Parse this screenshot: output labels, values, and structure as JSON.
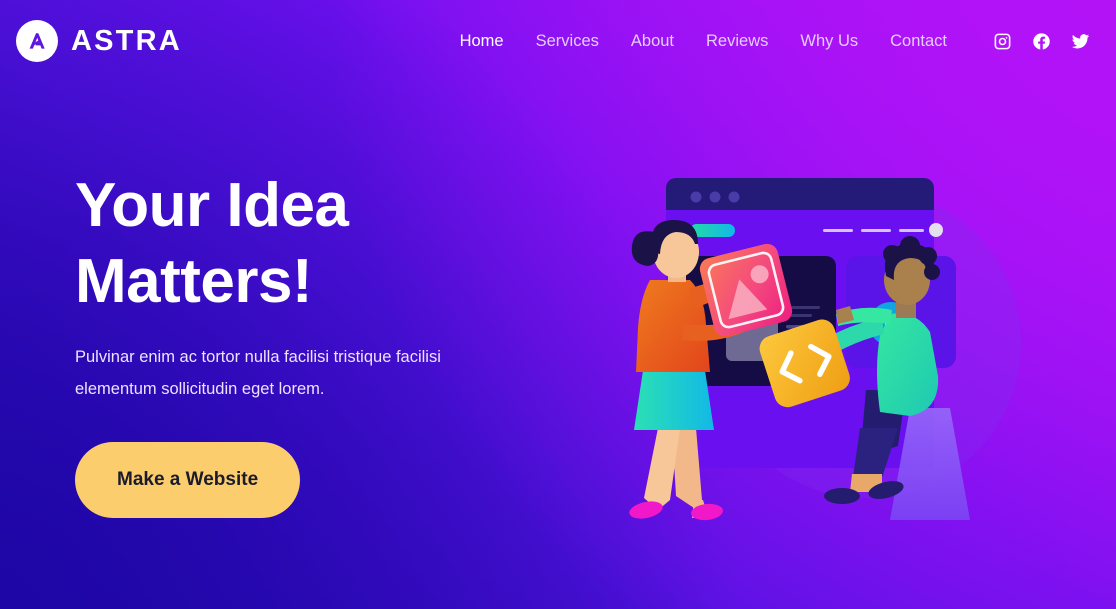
{
  "brand": {
    "name": "ASTRA",
    "logo_icon": "astra-a-logo",
    "logo_bg": "#FFFFFF",
    "logo_glyph_color": "#5C16E0"
  },
  "nav": {
    "items": [
      {
        "label": "Home",
        "active": true
      },
      {
        "label": "Services",
        "active": false
      },
      {
        "label": "About",
        "active": false
      },
      {
        "label": "Reviews",
        "active": false
      },
      {
        "label": "Why Us",
        "active": false
      },
      {
        "label": "Contact",
        "active": false
      }
    ]
  },
  "socials": [
    {
      "name": "instagram-icon",
      "label": "Instagram"
    },
    {
      "name": "facebook-icon",
      "label": "Facebook"
    },
    {
      "name": "twitter-icon",
      "label": "Twitter"
    }
  ],
  "hero": {
    "headline": "Your Idea\nMatters!",
    "subhead": "Pulvinar enim ac tortor nulla facilisi tristique facilisi elementum sollicitudin eget lorem.",
    "cta_label": "Make a Website"
  },
  "illustration": {
    "name": "team-building-website-illustration",
    "browser_mockup": {
      "titlebar_dots": 3,
      "nav_pill_colors": [
        "#22D9A8",
        "#13B9E8"
      ],
      "nav_lines": 3,
      "avatar_dot": "#E2E0EC",
      "video_play_button_color": "#0FA5E0"
    },
    "image_card": {
      "name": "image-placeholder-card",
      "colors": [
        "#F9674F",
        "#EE2B7A"
      ]
    },
    "code_card": {
      "name": "code-card",
      "symbol": "</>",
      "colors": [
        "#FBC13A",
        "#F0A417"
      ]
    },
    "person_left": {
      "name": "woman-holding-image-card",
      "hair": "#1B1247",
      "top": "#E8601F",
      "skirt": "#16C8C4",
      "shoes": "#F018C8"
    },
    "person_right": {
      "name": "man-holding-code-card",
      "hair": "#1B1247",
      "shirt": "#2BE39C",
      "pants": "#241C6E",
      "stool": "#8A58F5"
    }
  },
  "theme": {
    "bg_gradient_from": "#2309AD",
    "bg_gradient_mid": "#6C10EE",
    "bg_gradient_to": "#B313F8",
    "accent_yellow": "#FBCD6C",
    "text_light": "#EFE2FD",
    "panel_dark": "#150C46"
  }
}
